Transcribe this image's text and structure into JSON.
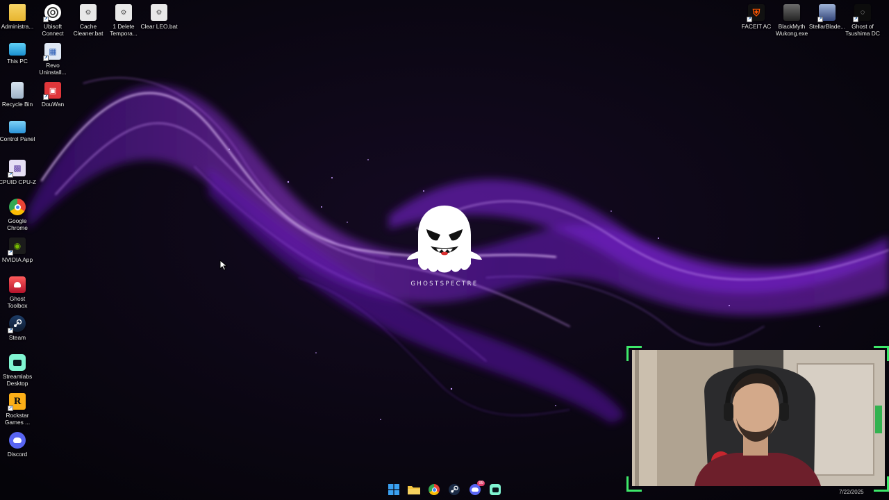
{
  "desktop": {
    "left_icons": [
      {
        "label": "Administra...",
        "icon": "folder-icon"
      },
      {
        "label": "Ubisoft\nConnect",
        "icon": "ubisoft-icon"
      },
      {
        "label": "Cache\nCleaner.bat",
        "icon": "bat-file-icon"
      },
      {
        "label": "1 Delete\nTempora...",
        "icon": "bat-file-icon"
      },
      {
        "label": "Clear LEO.bat",
        "icon": "bat-file-icon"
      },
      {
        "label": "This PC",
        "icon": "this-pc-icon"
      },
      {
        "label": "Revo\nUninstall...",
        "icon": "revo-uninstaller-icon"
      },
      {
        "label": "Recycle Bin",
        "icon": "recycle-bin-icon"
      },
      {
        "label": "DouWan",
        "icon": "douwan-icon"
      },
      {
        "label": "Control Panel",
        "icon": "control-panel-icon"
      },
      {
        "label": "CPUID CPU-Z",
        "icon": "cpuz-icon"
      },
      {
        "label": "Google\nChrome",
        "icon": "chrome-icon"
      },
      {
        "label": "NVIDIA App",
        "icon": "nvidia-icon"
      },
      {
        "label": "Ghost\nToolbox",
        "icon": "ghost-toolbox-icon"
      },
      {
        "label": "Steam",
        "icon": "steam-icon"
      },
      {
        "label": "Streamlabs\nDesktop",
        "icon": "streamlabs-icon"
      },
      {
        "label": "Rockstar\nGames ...",
        "icon": "rockstar-icon"
      },
      {
        "label": "Discord",
        "icon": "discord-icon"
      }
    ],
    "right_icons": [
      {
        "label": "FACEIT AC",
        "icon": "faceit-icon"
      },
      {
        "label": "BlackMyth\nWukong.exe",
        "icon": "blackmyth-icon"
      },
      {
        "label": "StellarBlade...",
        "icon": "stellarblade-icon"
      },
      {
        "label": "Ghost of\nTsushima DC",
        "icon": "ghost-of-tsushima-icon"
      }
    ]
  },
  "wallpaper": {
    "logo_text": "GHOSTSPECTRE",
    "accent": "#9b2cf0",
    "background": "#07060b"
  },
  "taskbar": {
    "apps": [
      "start-icon",
      "file-explorer-icon",
      "chrome-icon",
      "steam-icon",
      "discord-icon",
      "streamlabs-icon"
    ],
    "discord_badge": "99",
    "date": "7/22/2025"
  },
  "webcam": {
    "frame_color": "#3ee86a"
  }
}
